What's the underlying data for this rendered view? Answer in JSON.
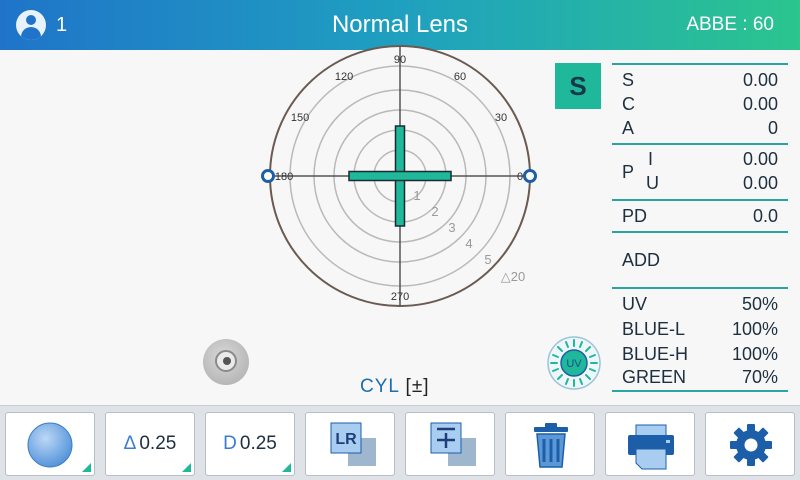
{
  "header": {
    "user_number": "1",
    "title": "Normal Lens",
    "abbe": "ABBE : 60"
  },
  "lens_mode_badge": "S",
  "dial": {
    "angle_labels": [
      "90",
      "60",
      "30",
      "0",
      "180",
      "150",
      "120",
      "270"
    ],
    "ring_labels": [
      "1",
      "2",
      "3",
      "4",
      "5",
      "△20"
    ]
  },
  "cyl_label": "CYL",
  "cyl_value": "[±]",
  "measurements": {
    "s": {
      "label": "S",
      "value": "0.00"
    },
    "c": {
      "label": "C",
      "value": "0.00"
    },
    "a": {
      "label": "A",
      "value": "0"
    },
    "p_label": "P",
    "p_i": {
      "label": "I",
      "value": "0.00"
    },
    "p_u": {
      "label": "U",
      "value": "0.00"
    },
    "pd": {
      "label": "PD",
      "value": "0.0"
    },
    "add": {
      "label": "ADD",
      "value": ""
    },
    "uv": {
      "label": "UV",
      "value": "50%"
    },
    "blue_l": {
      "label": "BLUE-L",
      "value": "100%"
    },
    "blue_h": {
      "label": "BLUE-H",
      "value": "100%"
    },
    "green": {
      "label": "GREEN",
      "value": "70%"
    }
  },
  "uv_icon_text": "UV",
  "toolbar": {
    "prism_step": {
      "prefix": "Δ",
      "value": "0.25"
    },
    "diopter_step": {
      "prefix": "D",
      "value": "0.25"
    },
    "lr_icon_text": "LR"
  },
  "colors": {
    "accent": "#1fb89a",
    "header_start": "#1f74c9",
    "header_end": "#2bc58e",
    "icon_blue": "#1c5fa8"
  }
}
